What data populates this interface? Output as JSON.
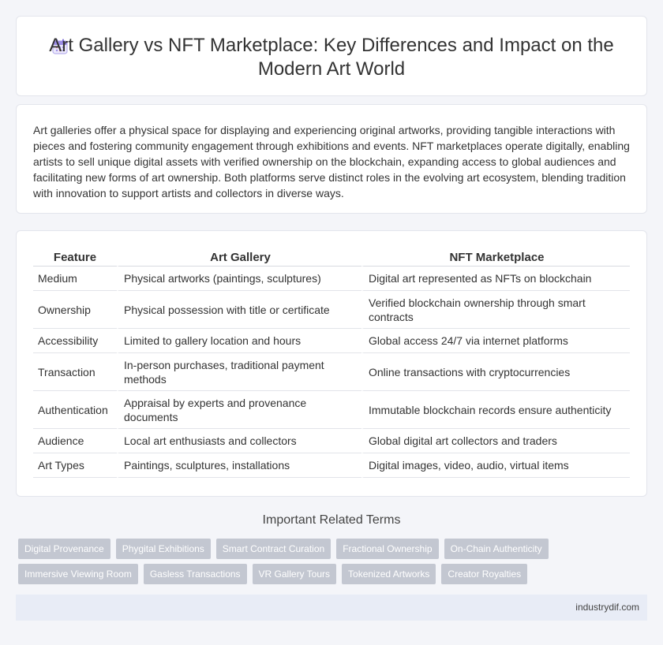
{
  "header": {
    "title": "Art Gallery vs NFT Marketplace: Key Differences and Impact on the Modern Art World",
    "icon": "calendar-icon"
  },
  "intro": "Art galleries offer a physical space for displaying and experiencing original artworks, providing tangible interactions with pieces and fostering community engagement through exhibitions and events. NFT marketplaces operate digitally, enabling artists to sell unique digital assets with verified ownership on the blockchain, expanding access to global audiences and facilitating new forms of art ownership. Both platforms serve distinct roles in the evolving art ecosystem, blending tradition with innovation to support artists and collectors in diverse ways.",
  "table": {
    "headers": [
      "Feature",
      "Art Gallery",
      "NFT Marketplace"
    ],
    "rows": [
      [
        "Medium",
        "Physical artworks (paintings, sculptures)",
        "Digital art represented as NFTs on blockchain"
      ],
      [
        "Ownership",
        "Physical possession with title or certificate",
        "Verified blockchain ownership through smart contracts"
      ],
      [
        "Accessibility",
        "Limited to gallery location and hours",
        "Global access 24/7 via internet platforms"
      ],
      [
        "Transaction",
        "In-person purchases, traditional payment methods",
        "Online transactions with cryptocurrencies"
      ],
      [
        "Authentication",
        "Appraisal by experts and provenance documents",
        "Immutable blockchain records ensure authenticity"
      ],
      [
        "Audience",
        "Local art enthusiasts and collectors",
        "Global digital art collectors and traders"
      ],
      [
        "Art Types",
        "Paintings, sculptures, installations",
        "Digital images, video, audio, virtual items"
      ]
    ]
  },
  "terms": {
    "heading": "Important Related Terms",
    "items": [
      "Digital Provenance",
      "Phygital Exhibitions",
      "Smart Contract Curation",
      "Fractional Ownership",
      "On-Chain Authenticity",
      "Immersive Viewing Room",
      "Gasless Transactions",
      "VR Gallery Tours",
      "Tokenized Artworks",
      "Creator Royalties"
    ]
  },
  "footer": {
    "site": "industrydif.com"
  }
}
